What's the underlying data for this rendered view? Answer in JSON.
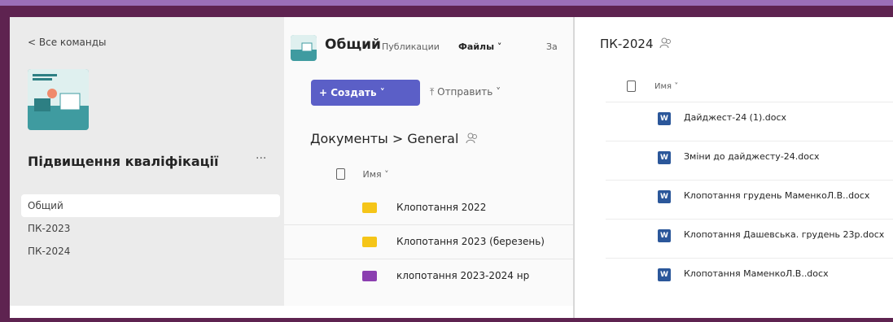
{
  "left": {
    "back_label": "< Все команды",
    "team_name": "Підвищення кваліфікації",
    "more": "···",
    "channels": [
      {
        "label": "Общий",
        "active": true
      },
      {
        "label": "ПК-2023",
        "active": false
      },
      {
        "label": "ПК-2024",
        "active": false
      }
    ]
  },
  "mid": {
    "title": "Общий",
    "tabs": [
      "Публикации",
      "Файлы ˅",
      "За"
    ],
    "create_label": "+ Создать ˅",
    "upload_label": "⤒ Отправить ˅",
    "breadcrumb": "Документы > General",
    "col_name": "Имя ˅",
    "rows": [
      {
        "name": "Клопотання 2022",
        "color": "#f5c518"
      },
      {
        "name": "Клопотання 2023 (березень)",
        "color": "#f5c518"
      },
      {
        "name": "клопотання 2023-2024 нр",
        "color": "#8b3fb0"
      }
    ]
  },
  "right": {
    "title": "ПК-2024",
    "col_name": "Имя ˅",
    "files": [
      "Дайджест-24  (1).docx",
      "Зміни до дайджесту-24.docx",
      "Клопотання грудень МаменкоЛ.В..docx",
      "Клопотання Дашевська. грудень 23р.docx",
      "Клопотання МаменкоЛ.В..docx"
    ]
  },
  "colors": {
    "accent": "#5b5fc7",
    "frame": "#5e2350",
    "outer": "#9b6fb8"
  }
}
